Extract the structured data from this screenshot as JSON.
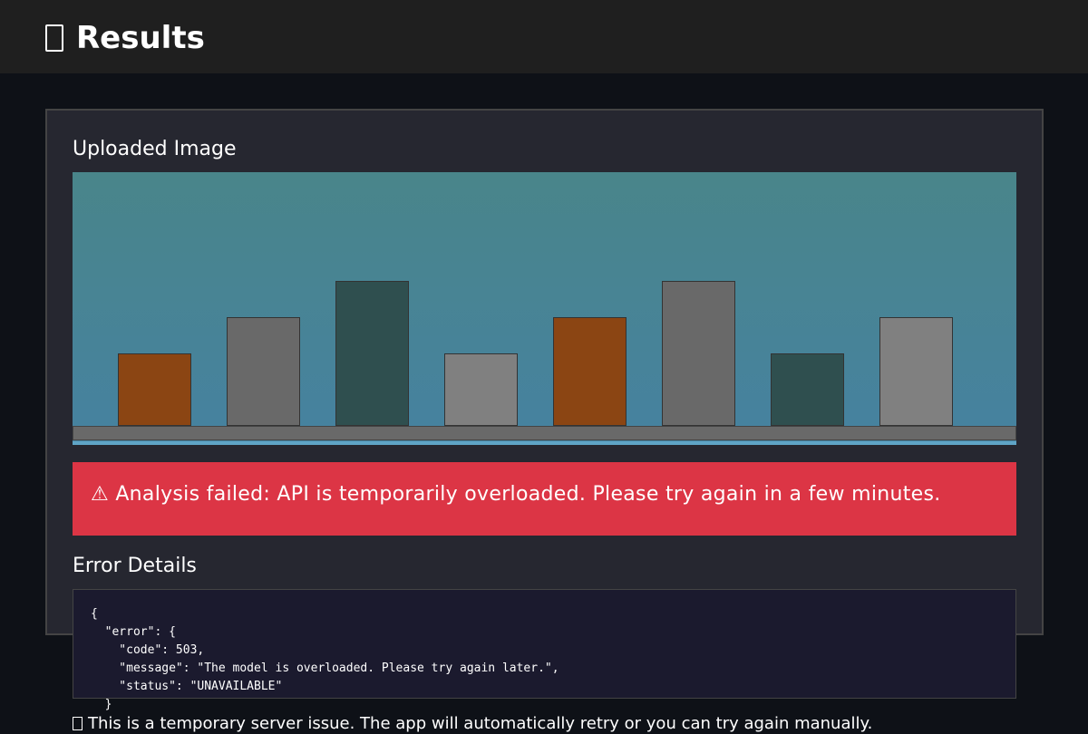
{
  "header": {
    "icon": "image-icon",
    "title": "Results"
  },
  "uploaded_image": {
    "heading": "Uploaded Image",
    "background_colors": [
      "#49858a",
      "#4682a0"
    ],
    "bar_colors": [
      "#8b4513",
      "#696969",
      "#2f4f4f",
      "#808080",
      "#8b4513",
      "#696969",
      "#2f4f4f",
      "#808080"
    ]
  },
  "alert": {
    "icon": "warning-icon",
    "color": "#dc3545",
    "message": "⚠ Analysis failed: API is temporarily overloaded. Please try again in a few minutes."
  },
  "error_details": {
    "heading": "Error Details",
    "lines": [
      "{",
      "  \"error\": {",
      "    \"code\": 503,",
      "    \"message\": \"The model is overloaded. Please try again later.\",",
      "    \"status\": \"UNAVAILABLE\"",
      "  }"
    ]
  },
  "note": {
    "icon": "info-icon",
    "text": "This is a temporary server issue. The app will automatically retry or you can try again manually."
  }
}
